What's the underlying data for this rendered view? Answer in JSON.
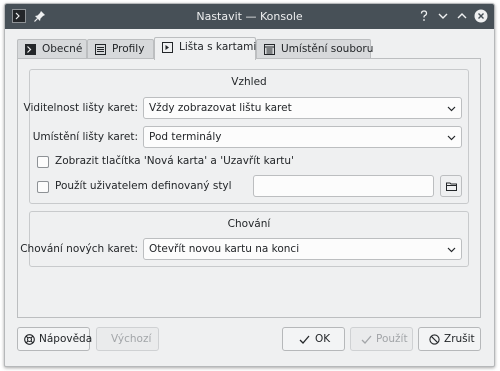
{
  "window": {
    "title": "Nastavit — Konsole"
  },
  "tabs": [
    {
      "label": "Obecné",
      "icon": "terminal-icon",
      "active": false
    },
    {
      "label": "Profily",
      "icon": "list-icon",
      "active": false
    },
    {
      "label": "Lišta s kartami",
      "icon": "tabs-icon",
      "active": true
    },
    {
      "label": "Umístění souboru",
      "icon": "folder-list-icon",
      "active": false
    }
  ],
  "appearance": {
    "title": "Vzhled",
    "tabbar_visibility_label": "Viditelnost lišty karet:",
    "tabbar_visibility_value": "Vždy zobrazovat lištu karet",
    "tabbar_position_label": "Umístění lišty karet:",
    "tabbar_position_value": "Pod terminály",
    "show_buttons_label": "Zobrazit tlačítka 'Nová karta' a 'Uzavřít kartu'",
    "show_buttons_checked": false,
    "custom_style_label": "Použít uživatelem definovaný styl",
    "custom_style_checked": false,
    "custom_style_path": ""
  },
  "behavior": {
    "title": "Chování",
    "new_tab_label": "Chování nových karet:",
    "new_tab_value": "Otevřít novou kartu na konci"
  },
  "buttons": {
    "help": "Nápověda",
    "defaults": "Výchozí",
    "ok": "OK",
    "apply": "Použít",
    "cancel": "Zrušit"
  },
  "colors": {
    "titlebar": "#475057",
    "window_bg": "#eff0f1",
    "disabled_text": "#a2a5a8"
  }
}
